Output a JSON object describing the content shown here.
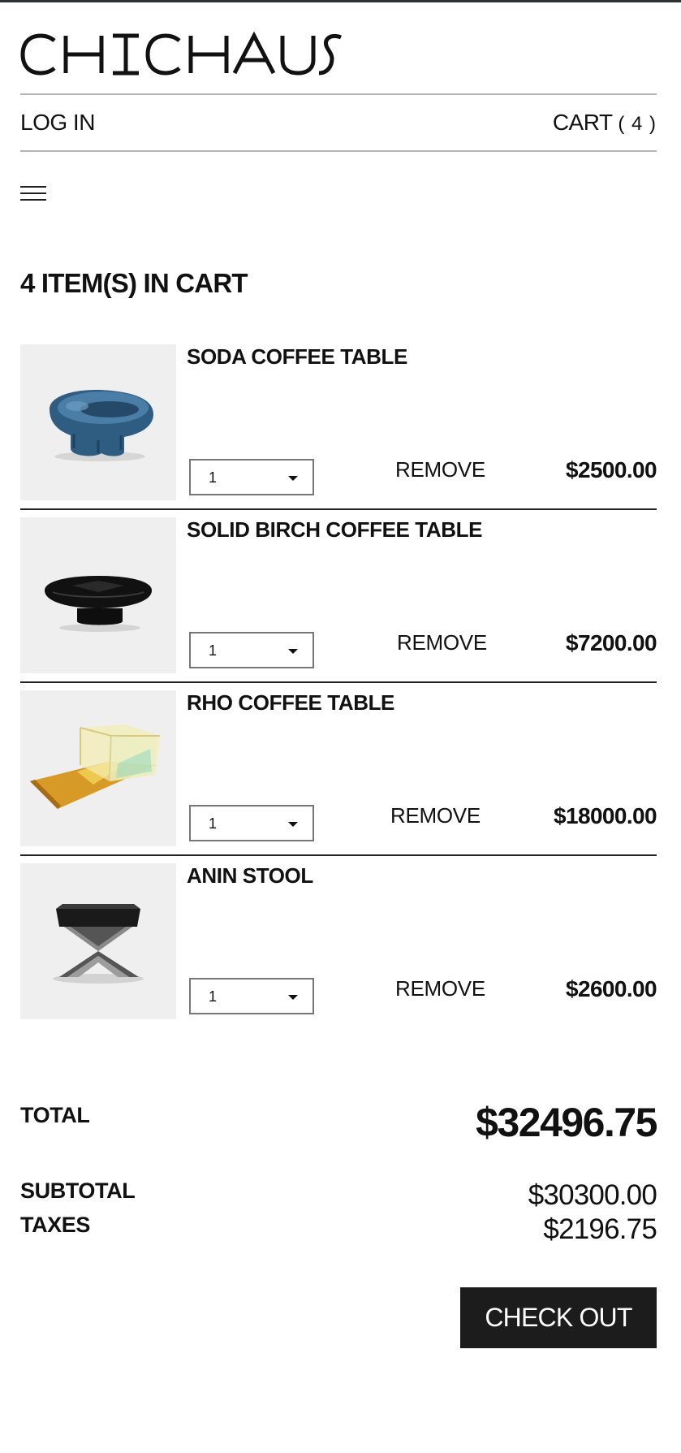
{
  "brand": {
    "name": "CHICHAUS"
  },
  "nav": {
    "login": "LOG IN",
    "cart_label": "CART",
    "cart_count": "( 4 )"
  },
  "menu_icon": "hamburger-menu-icon",
  "cart": {
    "heading": "4 ITEM(S) IN CART",
    "items": [
      {
        "name": "SODA COFFEE TABLE",
        "quantity": "1",
        "remove": "REMOVE",
        "price": "$2500.00",
        "thumbnail": "blue-glass-oval-table"
      },
      {
        "name": "SOLID BIRCH COFFEE TABLE",
        "quantity": "1",
        "remove": "REMOVE",
        "price": "$7200.00",
        "thumbnail": "black-pillow-table"
      },
      {
        "name": "RHO COFFEE TABLE",
        "quantity": "1",
        "remove": "REMOVE",
        "price": "$18000.00",
        "thumbnail": "iridescent-glass-table"
      },
      {
        "name": "ANIN STOOL",
        "quantity": "1",
        "remove": "REMOVE",
        "price": "$2600.00",
        "thumbnail": "x-base-stool"
      }
    ]
  },
  "summary": {
    "total_label": "TOTAL",
    "total_value": "$32496.75",
    "subtotal_label": "SUBTOTAL",
    "subtotal_value": "$30300.00",
    "taxes_label": "TAXES",
    "taxes_value": "$2196.75"
  },
  "checkout_label": "CHECK OUT",
  "colors": {
    "text": "#111111",
    "rule": "#b5b5b5",
    "thumb_bg": "#efefef",
    "button_bg": "#1c1c1c",
    "button_text": "#ffffff"
  }
}
